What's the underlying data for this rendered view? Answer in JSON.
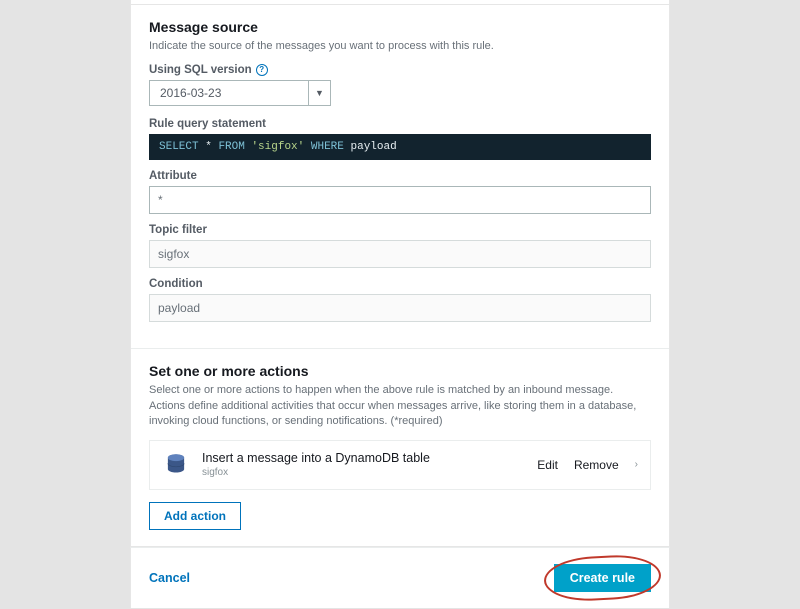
{
  "message_source": {
    "title": "Message source",
    "desc": "Indicate the source of the messages you want to process with this rule.",
    "sql_version_label": "Using SQL version",
    "sql_version_value": "2016-03-23",
    "rule_query_label": "Rule query statement",
    "rule_query_sql": {
      "select": "SELECT",
      "star": "*",
      "from": "FROM",
      "topic": "'sigfox'",
      "where": "WHERE",
      "cond": "payload"
    },
    "attribute_label": "Attribute",
    "attribute_value": "*",
    "topic_filter_label": "Topic filter",
    "topic_filter_value": "sigfox",
    "condition_label": "Condition",
    "condition_value": "payload"
  },
  "actions": {
    "title": "Set one or more actions",
    "desc": "Select one or more actions to happen when the above rule is matched by an inbound message. Actions define additional activities that occur when messages arrive, like storing them in a database, invoking cloud functions, or sending notifications. (*required)",
    "items": [
      {
        "title": "Insert a message into a DynamoDB table",
        "sub": "sigfox",
        "edit": "Edit",
        "remove": "Remove"
      }
    ],
    "add_label": "Add action"
  },
  "footer": {
    "cancel": "Cancel",
    "create": "Create rule"
  }
}
